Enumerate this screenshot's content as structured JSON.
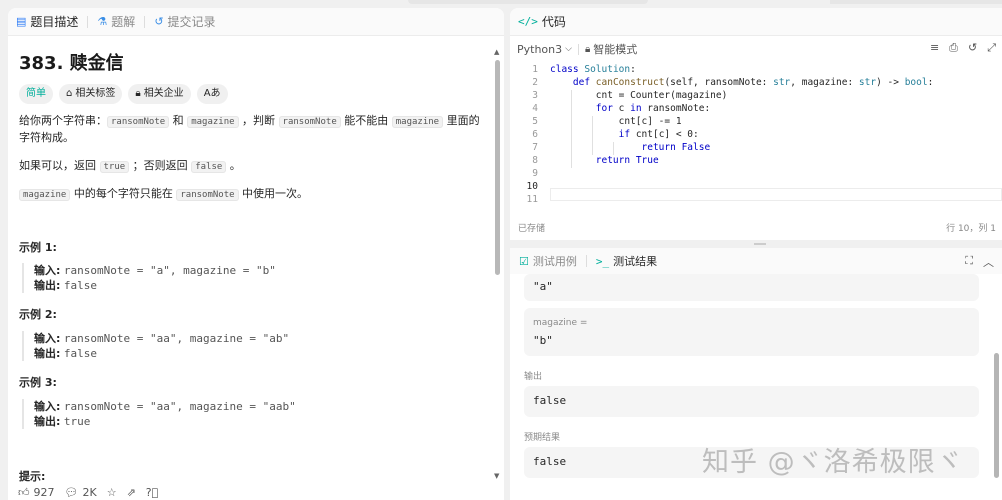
{
  "left_tabs": [
    {
      "label": "题目描述",
      "icon": "document-icon",
      "active": true
    },
    {
      "label": "题解",
      "icon": "flask-icon",
      "active": false
    },
    {
      "label": "提交记录",
      "icon": "history-icon",
      "active": false
    }
  ],
  "problem": {
    "title": "383. 赎金信",
    "tags": {
      "difficulty": "简单",
      "topics": "相关标签",
      "companies": "相关企业",
      "font_toggle": "Aあ"
    },
    "p1": {
      "a": "给你两个字符串：",
      "c1": "ransomNote",
      "b": " 和 ",
      "c2": "magazine",
      "c": " ，判断 ",
      "c3": "ransomNote",
      "d": " 能不能由 ",
      "c4": "magazine",
      "e": " 里面的字符构成。"
    },
    "p2": {
      "a": "如果可以，返回 ",
      "c1": "true",
      "b": " ；否则返回 ",
      "c2": "false",
      "c": " 。"
    },
    "p3": {
      "c1": "magazine",
      "a": " 中的每个字符只能在 ",
      "c2": "ransomNote",
      "b": " 中使用一次。"
    },
    "examples": [
      {
        "title": "示例 1:",
        "input_label": "输入:",
        "input": "ransomNote = \"a\", magazine = \"b\"",
        "output_label": "输出:",
        "output": "false"
      },
      {
        "title": "示例 2:",
        "input_label": "输入:",
        "input": "ransomNote = \"aa\", magazine = \"ab\"",
        "output_label": "输出:",
        "output": "false"
      },
      {
        "title": "示例 3:",
        "input_label": "输入:",
        "input": "ransomNote = \"aa\", magazine = \"aab\"",
        "output_label": "输出:",
        "output": "true"
      }
    ],
    "hint_title": "提示:"
  },
  "footer": {
    "likes": "927",
    "comments": "2K"
  },
  "code_panel": {
    "tab": "代码",
    "language": "Python3",
    "mode": "智能模式",
    "status_left": "已存储",
    "status_right": "行 10，列 1",
    "lines": [
      "1",
      "2",
      "3",
      "4",
      "5",
      "6",
      "7",
      "8",
      "9",
      "10",
      "11"
    ]
  },
  "result_panel": {
    "tab1": "测试用例",
    "tab2": "测试结果",
    "input_tail_value": "\"a\"",
    "magazine_label": "magazine =",
    "magazine_value": "\"b\"",
    "output_label": "输出",
    "output_value": "false",
    "expected_label": "预期结果",
    "expected_value": "false"
  },
  "watermark": "知乎 @ヾ洛希极限ヾ",
  "colors": {
    "easy": "#00af9b",
    "keyword": "#0000c8",
    "class": "#267f99",
    "function": "#795e26"
  }
}
